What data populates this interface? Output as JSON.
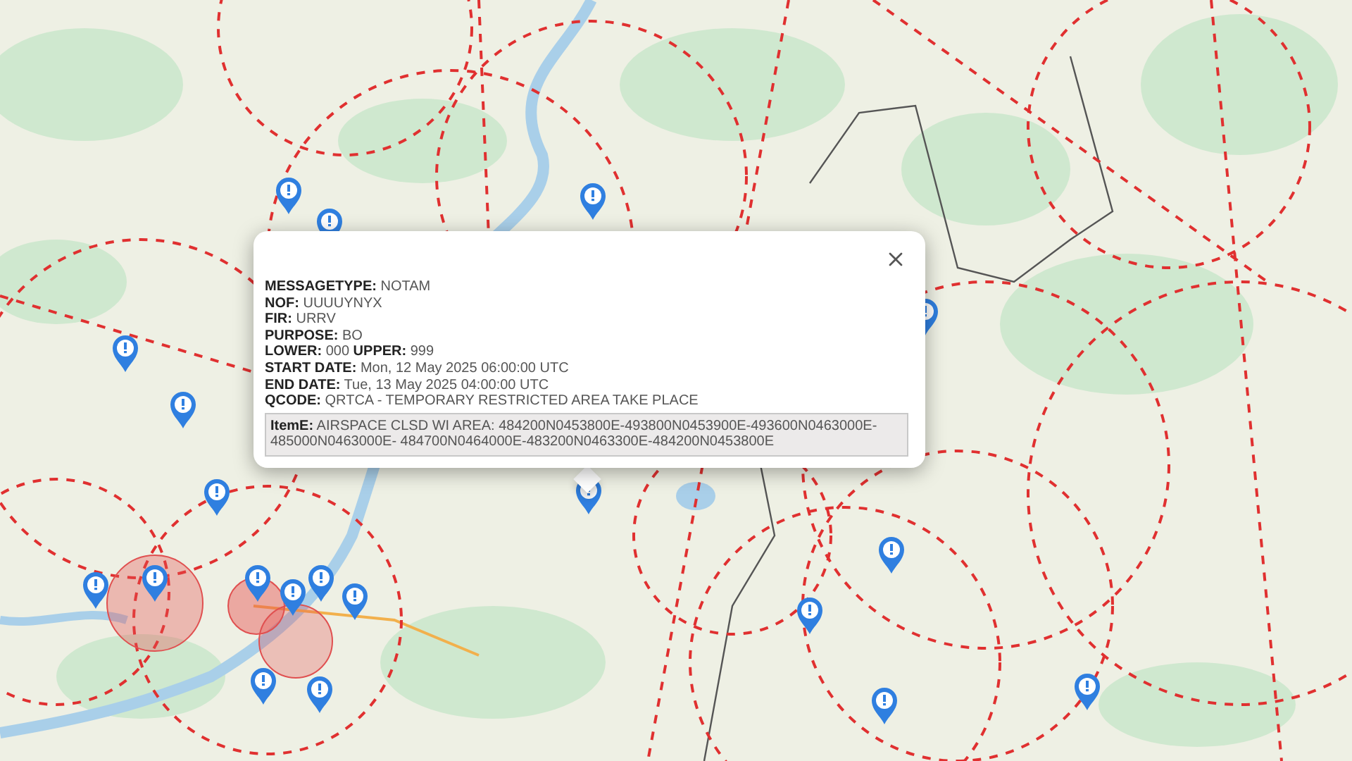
{
  "popup": {
    "lines": [
      "**MESSAGETYPE:** NOTAM",
      "**NOF:** UUUUYNYX",
      "**FIR:** URRV",
      "**PURPOSE:** BO",
      "**LOWER:** 000 **UPPER:** 999",
      "**START DATE:** Mon, 12 May 2025 06:00:00 UTC",
      "**END DATE:** Tue, 13 May 2025 04:00:00 UTC",
      "**QCODE:** QRTCA - TEMPORARY RESTRICTED AREA TAKE PLACE"
    ],
    "item_e": "**ItemE:** AIRSPACE CLSD WI AREA: 484200N0453800E-493800N0453900E-493600N0463000E-485000N0463000E- 484700N0464000E-483200N0463300E-484200N0453800E"
  }
}
